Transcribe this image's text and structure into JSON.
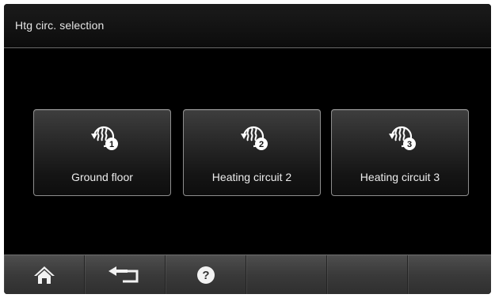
{
  "header": {
    "title": "Htg circ. selection"
  },
  "circuits": [
    {
      "label": "Ground floor",
      "number": "1",
      "icon": "heating-circuit-icon"
    },
    {
      "label": "Heating circuit 2",
      "number": "2",
      "icon": "heating-circuit-icon"
    },
    {
      "label": "Heating circuit 3",
      "number": "3",
      "icon": "heating-circuit-icon"
    }
  ],
  "nav": [
    {
      "icon": "home-icon"
    },
    {
      "icon": "back-arrow-icon"
    },
    {
      "icon": "help-icon"
    },
    {
      "icon": ""
    },
    {
      "icon": ""
    },
    {
      "icon": ""
    }
  ],
  "colors": {
    "background": "#000000",
    "text": "#ececec",
    "tile_border": "#8e8e8e",
    "bar": "#3a3a3a"
  }
}
